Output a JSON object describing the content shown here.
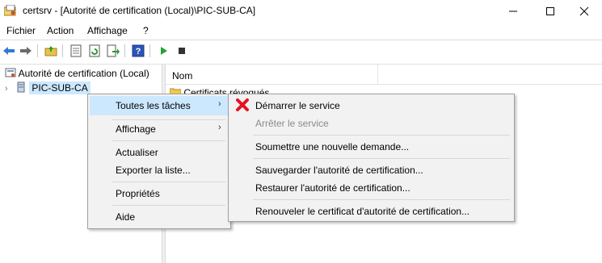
{
  "window": {
    "title": "certsrv - [Autorité de certification (Local)\\PIC-SUB-CA]"
  },
  "menubar": {
    "items": [
      "Fichier",
      "Action",
      "Affichage",
      "?"
    ]
  },
  "tree": {
    "root": "Autorité de certification (Local)",
    "node": "PIC-SUB-CA"
  },
  "list": {
    "column_name": "Nom",
    "first_item": "Certificats révoqués"
  },
  "context_menu": {
    "items": [
      {
        "label": "Toutes les tâches",
        "submenu": true
      },
      {
        "label": "Affichage",
        "submenu": true
      },
      {
        "label": "Actualiser"
      },
      {
        "label": "Exporter la liste..."
      },
      {
        "label": "Propriétés"
      },
      {
        "label": "Aide"
      }
    ]
  },
  "submenu": {
    "items": [
      {
        "label": "Démarrer le service"
      },
      {
        "label": "Arrêter le service",
        "disabled": true
      },
      {
        "label": "Soumettre une nouvelle demande..."
      },
      {
        "label": "Sauvegarder l'autorité de certification..."
      },
      {
        "label": "Restaurer l'autorité de certification..."
      },
      {
        "label": "Renouveler le certificat d'autorité de certification..."
      }
    ]
  },
  "colors": {
    "highlight": "#cce8ff",
    "selected_node": "#cce8ff",
    "red_x": "#e81123"
  }
}
